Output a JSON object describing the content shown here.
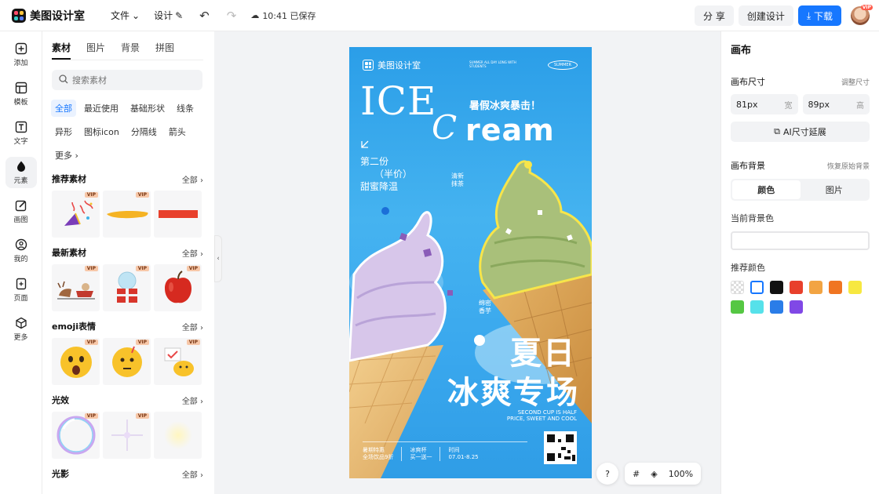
{
  "app": {
    "name": "美图设计室"
  },
  "menu": {
    "file": "文件",
    "design": "设计"
  },
  "status": {
    "saved": "10:41 已保存"
  },
  "topbar": {
    "share": "分 享",
    "create": "创建设计",
    "download": "下载",
    "avatar_badge": "VIP"
  },
  "leftnav": {
    "items": [
      {
        "label": "添加",
        "icon": "plus-square-icon"
      },
      {
        "label": "模板",
        "icon": "template-icon"
      },
      {
        "label": "文字",
        "icon": "text-icon"
      },
      {
        "label": "元素",
        "icon": "shapes-icon",
        "active": true
      },
      {
        "label": "画图",
        "icon": "draw-icon"
      },
      {
        "label": "我的",
        "icon": "user-icon"
      },
      {
        "label": "页面",
        "icon": "add-page-icon"
      },
      {
        "label": "更多",
        "icon": "cube-icon"
      }
    ]
  },
  "panel": {
    "tabs": [
      "素材",
      "图片",
      "背景",
      "拼图"
    ],
    "search_placeholder": "搜索素材",
    "chips": [
      "全部",
      "最近使用",
      "基础形状",
      "线条",
      "异形",
      "图标icon",
      "分隔线",
      "箭头",
      "更多"
    ],
    "all": "全部",
    "vip": "VIP",
    "sections": {
      "recommended": "推荐素材",
      "latest": "最新素材",
      "emoji": "emoji表情",
      "light": "光效",
      "shadow": "光影"
    }
  },
  "poster": {
    "brand": "美图设计室",
    "tiny": "SUMMER ALL DAY LONG WITH STUDENTS",
    "summer_badge": "SUMMER",
    "ice": "ICE",
    "cream": "ream",
    "cream_c": "C",
    "slogan": "暑假冰爽暴击！",
    "second_line1": "第二份",
    "second_line2": "（半价）",
    "second_line3": "甜蜜降温",
    "note1_l1": "清新",
    "note1_l2": "抹茶",
    "note2_l1": "绵密",
    "note2_l2": "香芋",
    "big1": "夏日",
    "big2": "冰爽专场",
    "en_l1": "SECOND CUP IS HALF",
    "en_l2": "PRICE, SWEET AND COOL",
    "foot1_l1": "暑期特惠",
    "foot1_l2": "全场饮品9折",
    "foot2_l1": "冰爽杯",
    "foot2_l2": "买一送一",
    "foot3_l1": "时间",
    "foot3_l2": "07.01-8.25"
  },
  "float_tools": {
    "help": "?",
    "zoom": "100%"
  },
  "right": {
    "title": "画布",
    "size_label": "画布尺寸",
    "adjust_size": "调整尺寸",
    "width_value": "81px",
    "width_unit": "宽",
    "height_value": "89px",
    "height_unit": "高",
    "ai_extend": "AI尺寸延展",
    "bg_label": "画布背景",
    "restore_bg": "恢复原始背景",
    "seg_color": "颜色",
    "seg_image": "图片",
    "current_bg": "当前背景色",
    "recommended_colors": "推荐颜色",
    "swatches": [
      "transparent",
      "#ffffff",
      "#111111",
      "#e8402c",
      "#f2a443",
      "#f07522",
      "#f7e840",
      "#55c743",
      "#56e1ea",
      "#2a7de8",
      "#8048e6"
    ]
  }
}
